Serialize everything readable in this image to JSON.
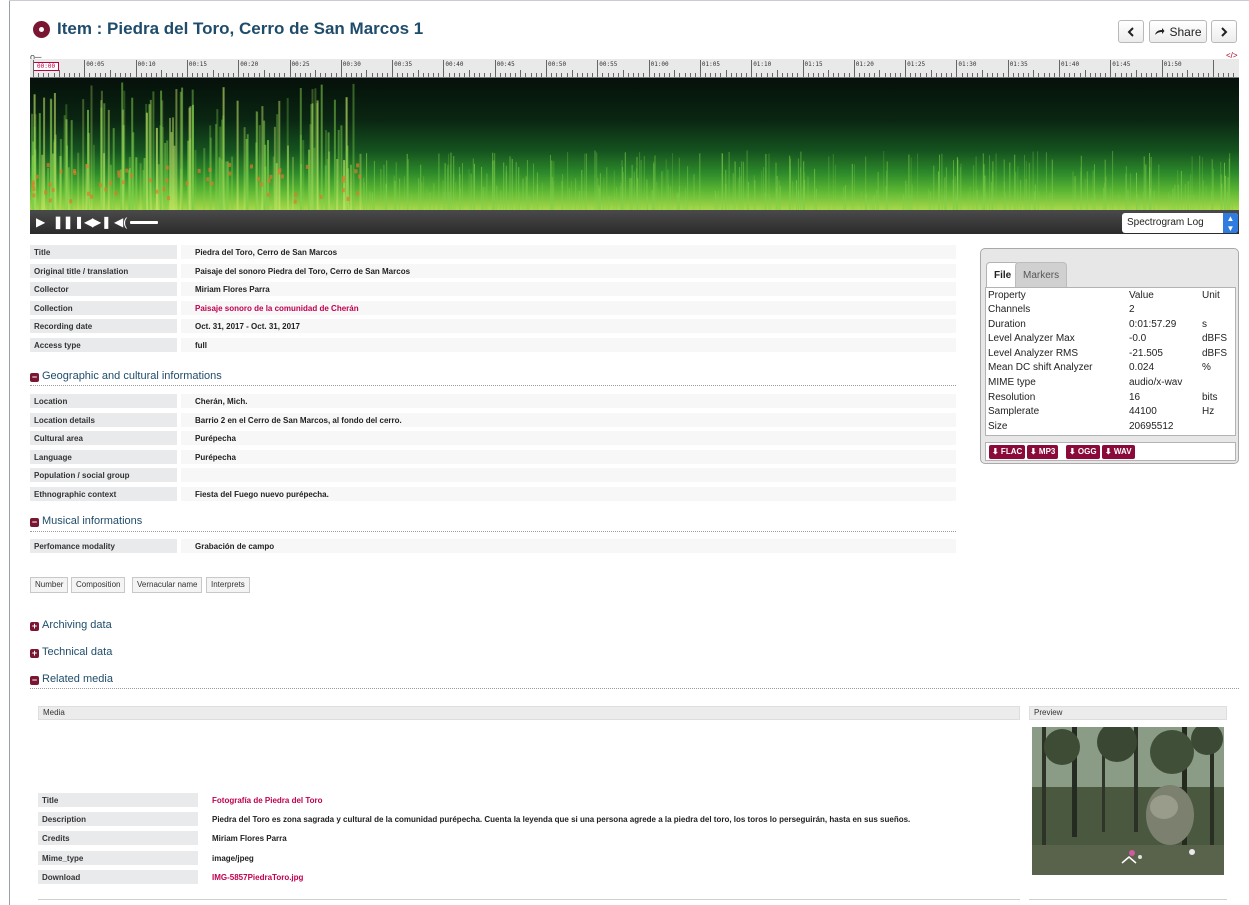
{
  "header": {
    "title": "Item : Piedra del Toro, Cerro de San Marcos 1",
    "prev_icon": "chevron-left-icon",
    "next_icon": "chevron-right-icon",
    "share_icon": "share-arrow-icon",
    "share_label": "Share"
  },
  "player": {
    "current_time": "00:00",
    "ticks": [
      "00:05",
      "00:10",
      "00:15",
      "00:20",
      "00:25",
      "00:30",
      "00:35",
      "00:40",
      "00:45",
      "00:50",
      "00:55",
      "01:00",
      "01:05",
      "01:10",
      "01:15",
      "01:20",
      "01:25",
      "01:30",
      "01:35",
      "01:40",
      "01:45",
      "01:50"
    ],
    "zoom_icon": "zoom-key-icon",
    "embed_icon": "embed-code-icon",
    "controls": {
      "play": "play-icon",
      "pause": "pause-icon",
      "rewind": "skip-back-icon",
      "forward": "skip-forward-icon",
      "volume": "volume-icon",
      "volume_level": 1.0
    },
    "mode": "Spectrogram Log"
  },
  "metadata": [
    {
      "label": "Title",
      "value": "Piedra del Toro, Cerro de San Marcos"
    },
    {
      "label": "Original title / translation",
      "value": "Paisaje del sonoro Piedra del Toro, Cerro de San Marcos"
    },
    {
      "label": "Collector",
      "value": "Miriam Flores Parra"
    },
    {
      "label": "Collection",
      "value": "Paisaje sonoro de la comunidad de Cherán"
    },
    {
      "label": "Recording date",
      "value": "Oct. 31, 2017 - Oct. 31, 2017"
    },
    {
      "label": "Access type",
      "value": "full"
    }
  ],
  "geo": {
    "heading": "Geographic and cultural informations",
    "rows": [
      {
        "label": "Location",
        "value": "Cherán, Mich."
      },
      {
        "label": "Location details",
        "value": "Barrio 2 en el Cerro de San Marcos, al fondo del cerro."
      },
      {
        "label": "Cultural area",
        "value": "Purépecha"
      },
      {
        "label": "Language",
        "value": "Purépecha"
      },
      {
        "label": "Population / social group",
        "value": ""
      },
      {
        "label": "Ethnographic context",
        "value": "Fiesta del Fuego nuevo purépecha."
      }
    ]
  },
  "musical": {
    "heading": "Musical informations",
    "rows": [
      {
        "label": "Perfomance modality",
        "value": "Grabación de campo"
      }
    ],
    "chips": [
      "Number",
      "Composition",
      "Vernacular name",
      "Interprets"
    ]
  },
  "sections": {
    "archiving": "Archiving data",
    "technical": "Technical data",
    "related": "Related media"
  },
  "file_panel": {
    "tabs": [
      "File",
      "Markers"
    ],
    "columns": [
      "Property",
      "Value",
      "Unit"
    ],
    "rows": [
      {
        "property": "Channels",
        "value": "2",
        "unit": ""
      },
      {
        "property": "Duration",
        "value": "0:01:57.29",
        "unit": "s"
      },
      {
        "property": "Level Analyzer Max",
        "value": "-0.0",
        "unit": "dBFS"
      },
      {
        "property": "Level Analyzer RMS",
        "value": "-21.505",
        "unit": "dBFS"
      },
      {
        "property": "Mean DC shift Analyzer",
        "value": "0.024",
        "unit": "%"
      },
      {
        "property": "MIME type",
        "value": "audio/x-wav",
        "unit": ""
      },
      {
        "property": "Resolution",
        "value": "16",
        "unit": "bits"
      },
      {
        "property": "Samplerate",
        "value": "44100",
        "unit": "Hz"
      },
      {
        "property": "Size",
        "value": "20695512",
        "unit": ""
      }
    ],
    "downloads": [
      "⬇ FLAC",
      "⬇ MP3",
      "⬇ OGG",
      "⬇ WAV"
    ]
  },
  "related_media": {
    "col_media": "Media",
    "col_preview": "Preview",
    "rows": [
      {
        "label": "Title",
        "value": "Fotografía de Piedra del Toro"
      },
      {
        "label": "Description",
        "value": "Piedra del Toro es zona sagrada y cultural de la comunidad purépecha. Cuenta la leyenda que si una persona agrede a la piedra del toro, los toros lo perseguirán, hasta en sus sueños."
      },
      {
        "label": "Credits",
        "value": "Miriam Flores Parra"
      },
      {
        "label": "Mime_type",
        "value": "image/jpeg"
      },
      {
        "label": "Download",
        "value": "IMG-5857PiedraToro.jpg"
      }
    ]
  },
  "colors": {
    "brand": "#7a1632",
    "link": "#c0004f",
    "heading": "#1f4c6b",
    "select_accent": "#2f7ce0"
  }
}
